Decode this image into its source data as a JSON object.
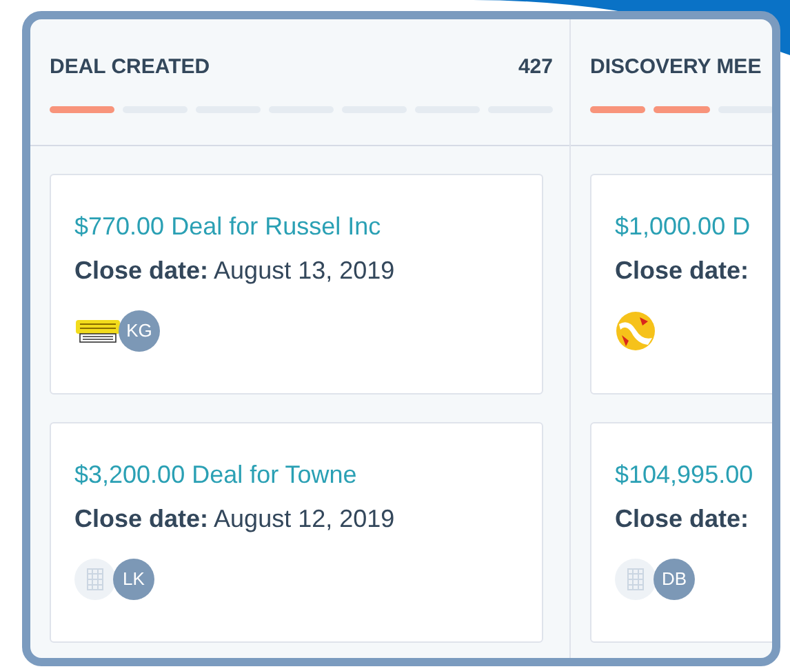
{
  "columns": [
    {
      "title": "DEAL CREATED",
      "count": "427",
      "segments": [
        {
          "filled": true
        },
        {
          "filled": false
        },
        {
          "filled": false
        },
        {
          "filled": false
        },
        {
          "filled": false
        },
        {
          "filled": false
        },
        {
          "filled": false
        }
      ],
      "cards": [
        {
          "title": "$770.00 Deal for Russel Inc",
          "close": "**Close date:** August 13, 2019",
          "logo": {
            "kind": "comic"
          },
          "owner": "KG"
        },
        {
          "title": "$3,200.00 Deal for Towne",
          "close": "**Close date:** August 12, 2019",
          "logo": {
            "kind": "building"
          },
          "owner": "LK"
        }
      ]
    },
    {
      "title": "DISCOVERY MEE",
      "segments": [
        {
          "filled": true
        },
        {
          "filled": true
        },
        {
          "filled": false
        }
      ],
      "cards": [
        {
          "title": "$1,000.00 D",
          "close": "**Close date:**",
          "logo": {
            "kind": "sphere"
          }
        },
        {
          "title": "$104,995.00",
          "close": "**Close date:**",
          "logo": {
            "kind": "building"
          },
          "owner": "DB"
        }
      ]
    }
  ]
}
